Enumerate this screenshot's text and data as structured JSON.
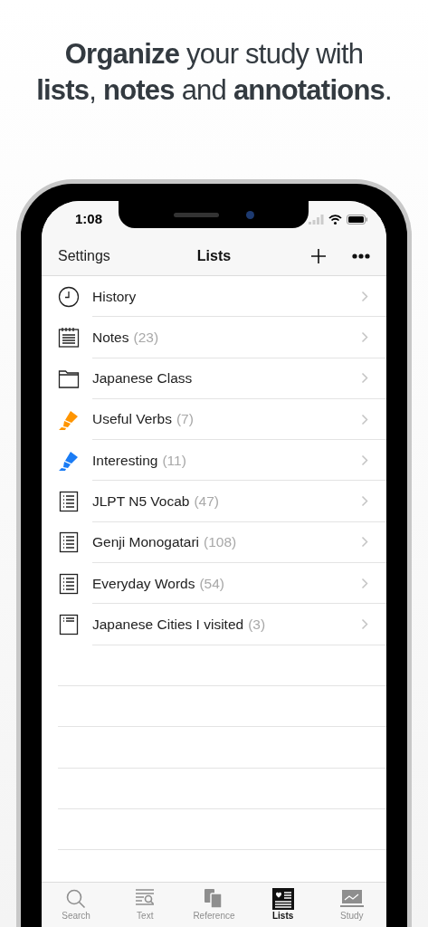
{
  "headline": [
    "**Organize** your study with",
    "**lists**, **notes** and **annotations**."
  ],
  "status_bar": {
    "time": "1:08"
  },
  "nav_bar": {
    "left": "Settings",
    "title": "Lists"
  },
  "lists": [
    {
      "kind": "clock",
      "name": "History"
    },
    {
      "kind": "notepad",
      "name": "Notes",
      "count": "(23)"
    },
    {
      "kind": "folder",
      "name": "Japanese Class"
    },
    {
      "kind": "highlighter",
      "name": "Useful Verbs",
      "count": "(7)",
      "color": "#ff9500"
    },
    {
      "kind": "highlighter",
      "name": "Interesting",
      "count": "(11)",
      "color": "#1a7cf5"
    },
    {
      "kind": "list",
      "name": "JLPT N5 Vocab",
      "count": "(47)"
    },
    {
      "kind": "list",
      "name": "Genji Monogatari",
      "count": "(108)"
    },
    {
      "kind": "list",
      "name": "Everyday Words",
      "count": "(54)"
    },
    {
      "kind": "short-list",
      "name": "Japanese Cities I visited",
      "count": "(3)"
    }
  ],
  "tabs": [
    {
      "kind": "search",
      "label": "Search",
      "selected": false
    },
    {
      "kind": "text",
      "label": "Text",
      "selected": false
    },
    {
      "kind": "reference",
      "label": "Reference",
      "selected": false
    },
    {
      "kind": "lists",
      "label": "Lists",
      "selected": true
    },
    {
      "kind": "study",
      "label": "Study",
      "selected": false
    }
  ]
}
